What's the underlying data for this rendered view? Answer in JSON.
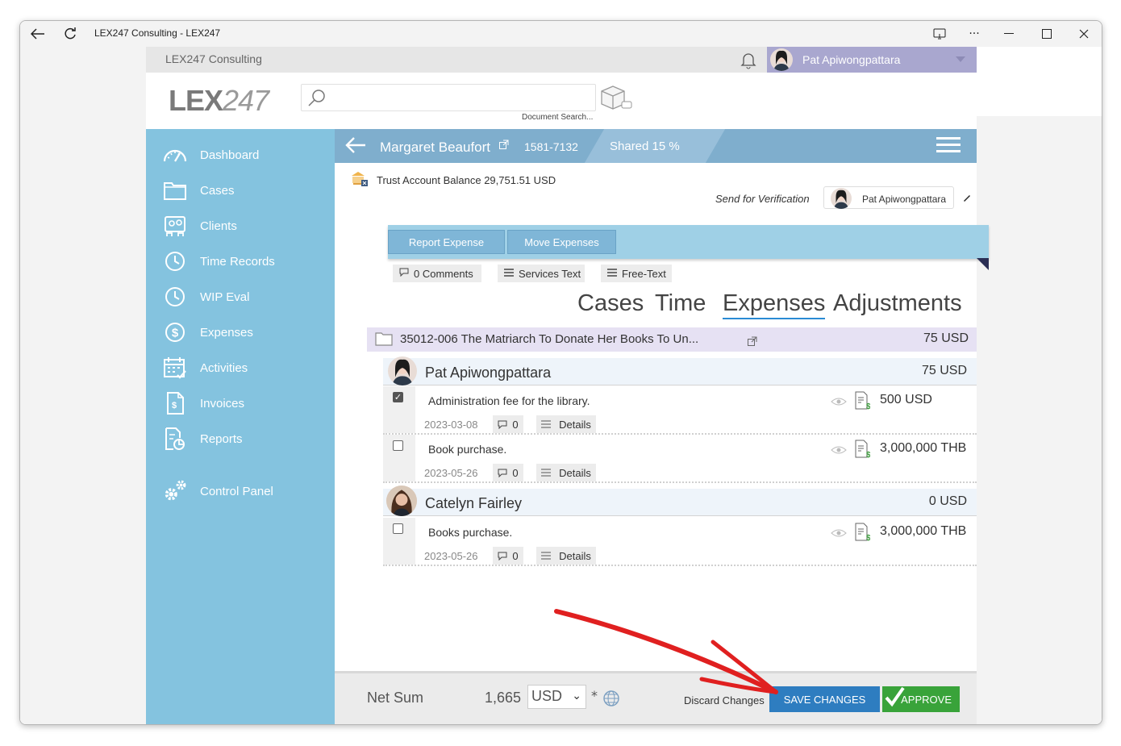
{
  "window": {
    "title": "LEX247 Consulting - LEX247"
  },
  "app": {
    "org_name": "LEX247 Consulting",
    "logo_primary": "LEX",
    "logo_secondary": "247",
    "user_name": "Pat Apiwongpattara"
  },
  "search": {
    "placeholder": "",
    "caption": "Document Search..."
  },
  "sidebar": {
    "items": [
      {
        "label": "Dashboard",
        "icon": "gauge-icon"
      },
      {
        "label": "Cases",
        "icon": "folder-icon"
      },
      {
        "label": "Clients",
        "icon": "clients-icon"
      },
      {
        "label": "Time Records",
        "icon": "clock-icon"
      },
      {
        "label": "WIP Eval",
        "icon": "clock-icon"
      },
      {
        "label": "Expenses",
        "icon": "dollar-icon"
      },
      {
        "label": "Activities",
        "icon": "calendar-check-icon"
      },
      {
        "label": "Invoices",
        "icon": "invoice-icon"
      },
      {
        "label": "Reports",
        "icon": "report-icon"
      },
      {
        "label": "Control Panel",
        "icon": "gears-icon"
      }
    ]
  },
  "case": {
    "client_name": "Margaret Beaufort",
    "number": "1581-7132",
    "shared": "Shared 15 %",
    "trust_balance": "Trust Account Balance 29,751.51 USD",
    "send_verification_label": "Send for Verification",
    "verifier": "Pat Apiwongpattara"
  },
  "actions": {
    "report_expense": "Report Expense",
    "move_expenses": "Move Expenses"
  },
  "filters": {
    "comments": "0 Comments",
    "services_text": "Services Text",
    "free_text": "Free-Text"
  },
  "tabs": [
    {
      "label": "Cases",
      "active": false
    },
    {
      "label": "Time",
      "active": false
    },
    {
      "label": "Expenses",
      "active": true
    },
    {
      "label": "Adjustments",
      "active": false
    }
  ],
  "matter": {
    "title": "35012-006 The Matriarch To Donate Her Books To Un...",
    "amount": "75 USD"
  },
  "groups": [
    {
      "person": "Pat Apiwongpattara",
      "total": "75 USD",
      "entries": [
        {
          "description": "Administration fee for the library.",
          "date": "2023-03-08",
          "comments": "0",
          "details": "Details",
          "amount": "500 USD",
          "checked": true
        }
      ]
    },
    {
      "person": "",
      "total": "",
      "entries": [
        {
          "description": "Book purchase.",
          "date": "2023-05-26",
          "comments": "0",
          "details": "Details",
          "amount": "3,000,000 THB",
          "checked": false
        }
      ]
    },
    {
      "person": "Catelyn Fairley",
      "total": "0 USD",
      "entries": [
        {
          "description": "Books purchase.",
          "date": "2023-05-26",
          "comments": "0",
          "details": "Details",
          "amount": "3,000,000 THB",
          "checked": false
        }
      ]
    }
  ],
  "footer": {
    "net_sum_label": "Net Sum",
    "net_sum_value": "1,665",
    "currency": "USD",
    "asterisk": "*",
    "discard": "Discard Changes",
    "save": "SAVE CHANGES",
    "approve": "APPROVE"
  },
  "colors": {
    "sidebar": "#84c3df",
    "case_bar": "#7faecd",
    "save": "#2e7dc0",
    "approve": "#39a33a",
    "user_box": "#a9a7cf",
    "annotation": "#e02020"
  }
}
